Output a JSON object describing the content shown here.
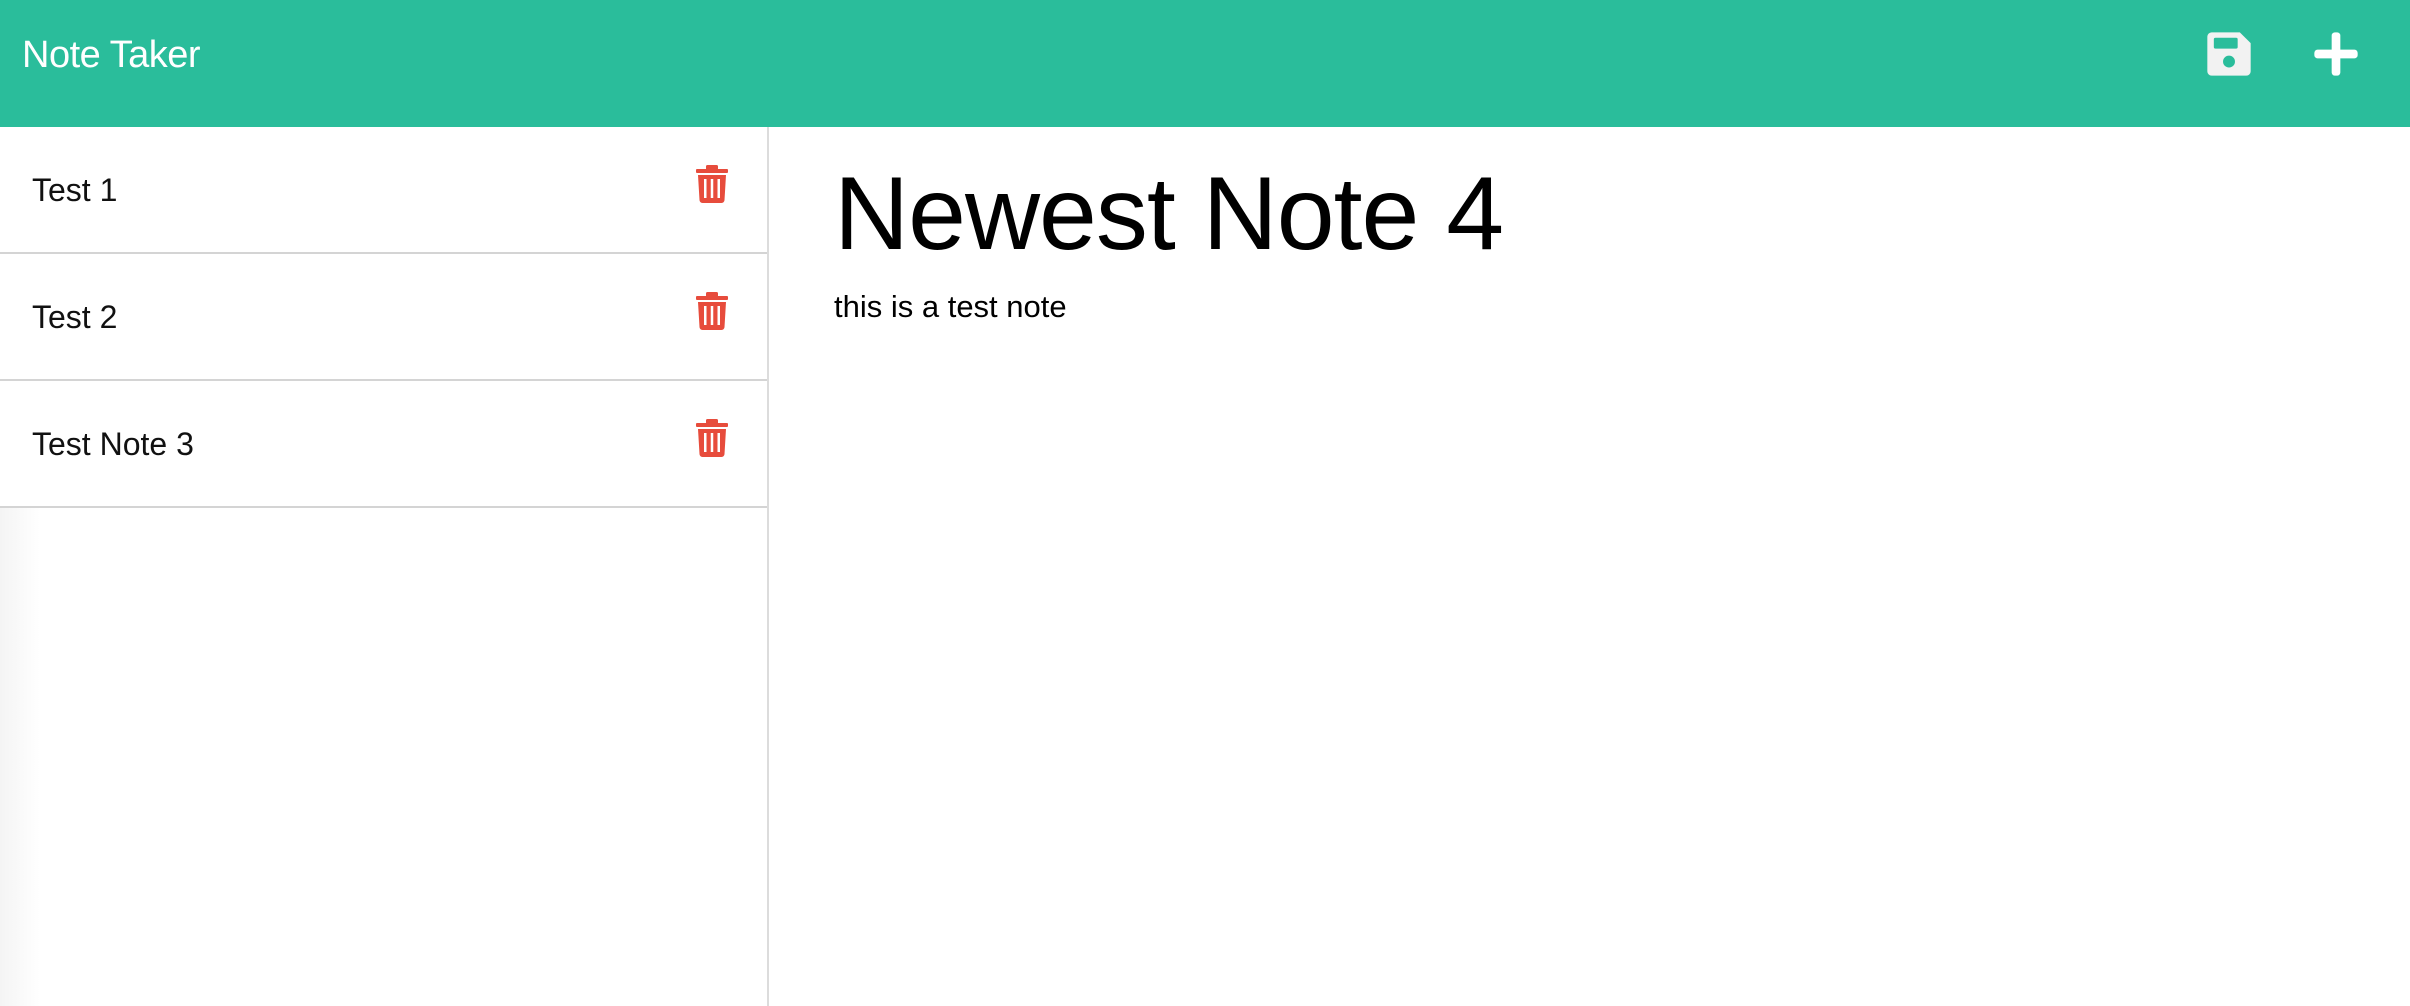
{
  "header": {
    "brand": "Note Taker",
    "background_color": "#2abd9b",
    "actions": [
      {
        "name": "save-note",
        "icon": "floppy-disk-icon"
      },
      {
        "name": "new-note",
        "icon": "plus-icon"
      }
    ]
  },
  "sidebar": {
    "notes": [
      {
        "title": "Test 1",
        "delete_icon": "trash-icon"
      },
      {
        "title": "Test 2",
        "delete_icon": "trash-icon"
      },
      {
        "title": "Test Note 3",
        "delete_icon": "trash-icon"
      }
    ],
    "delete_icon_color": "#e74c3c"
  },
  "editor": {
    "title": "Newest Note 4",
    "body": "this is a test note"
  }
}
